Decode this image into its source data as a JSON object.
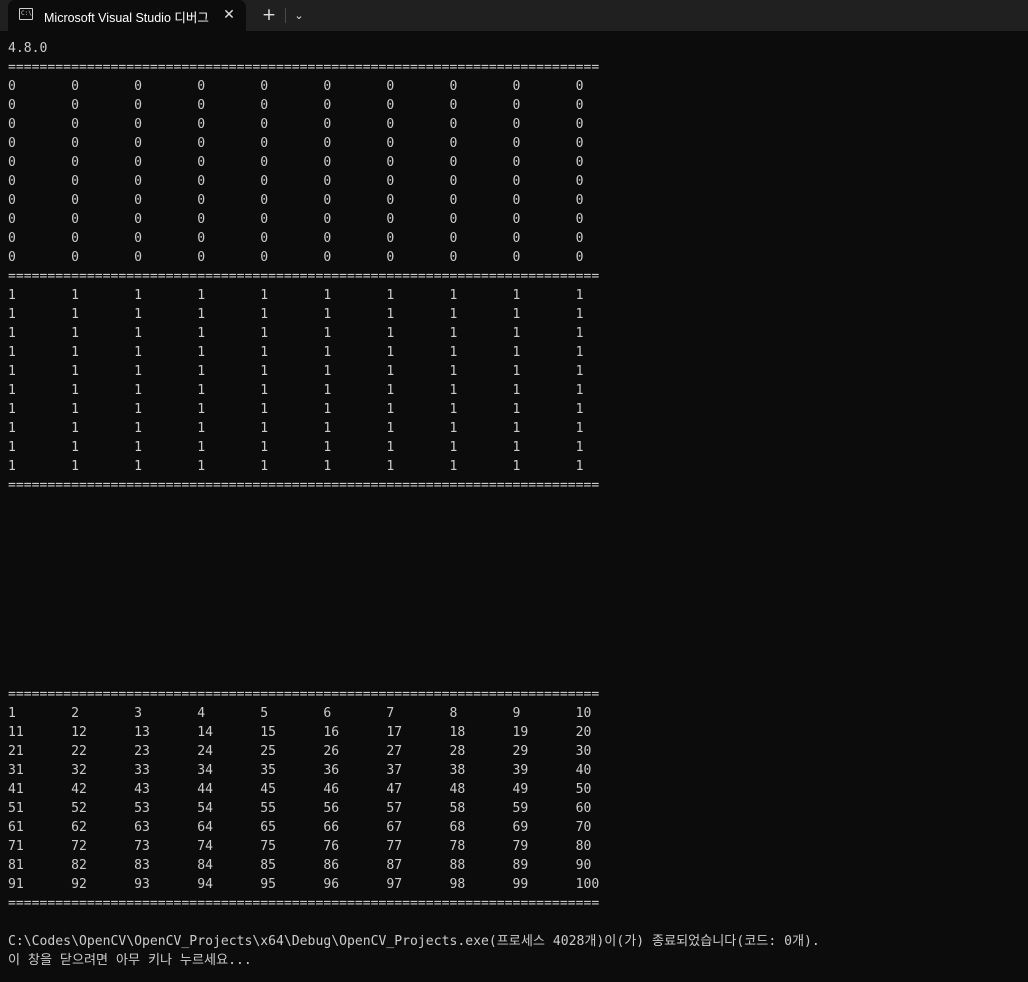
{
  "titlebar": {
    "tab_title": "Microsoft Visual Studio 디버그",
    "tab_icon_glyph": "C:\\",
    "close_glyph": "✕",
    "new_tab_glyph": "+",
    "dropdown_glyph": "⌄",
    "tab_icon": "console-icon"
  },
  "console": {
    "lines": [
      "4.8.0",
      "===========================================================================",
      "0       0       0       0       0       0       0       0       0       0",
      "0       0       0       0       0       0       0       0       0       0",
      "0       0       0       0       0       0       0       0       0       0",
      "0       0       0       0       0       0       0       0       0       0",
      "0       0       0       0       0       0       0       0       0       0",
      "0       0       0       0       0       0       0       0       0       0",
      "0       0       0       0       0       0       0       0       0       0",
      "0       0       0       0       0       0       0       0       0       0",
      "0       0       0       0       0       0       0       0       0       0",
      "0       0       0       0       0       0       0       0       0       0",
      "===========================================================================",
      "1       1       1       1       1       1       1       1       1       1",
      "1       1       1       1       1       1       1       1       1       1",
      "1       1       1       1       1       1       1       1       1       1",
      "1       1       1       1       1       1       1       1       1       1",
      "1       1       1       1       1       1       1       1       1       1",
      "1       1       1       1       1       1       1       1       1       1",
      "1       1       1       1       1       1       1       1       1       1",
      "1       1       1       1       1       1       1       1       1       1",
      "1       1       1       1       1       1       1       1       1       1",
      "1       1       1       1       1       1       1       1       1       1",
      "===========================================================================",
      "",
      "",
      "",
      "",
      "",
      "",
      "",
      "",
      "",
      "",
      "===========================================================================",
      "1       2       3       4       5       6       7       8       9       10",
      "11      12      13      14      15      16      17      18      19      20",
      "21      22      23      24      25      26      27      28      29      30",
      "31      32      33      34      35      36      37      38      39      40",
      "41      42      43      44      45      46      47      48      49      50",
      "51      52      53      54      55      56      57      58      59      60",
      "61      62      63      64      65      66      67      68      69      70",
      "71      72      73      74      75      76      77      78      79      80",
      "81      82      83      84      85      86      87      88      89      90",
      "91      92      93      94      95      96      97      98      99      100",
      "===========================================================================",
      "",
      "C:\\Codes\\OpenCV\\OpenCV_Projects\\x64\\Debug\\OpenCV_Projects.exe(프로세스 4028개)이(가) 종료되었습니다(코드: 0개).",
      "이 창을 닫으려면 아무 키나 누르세요..."
    ]
  }
}
